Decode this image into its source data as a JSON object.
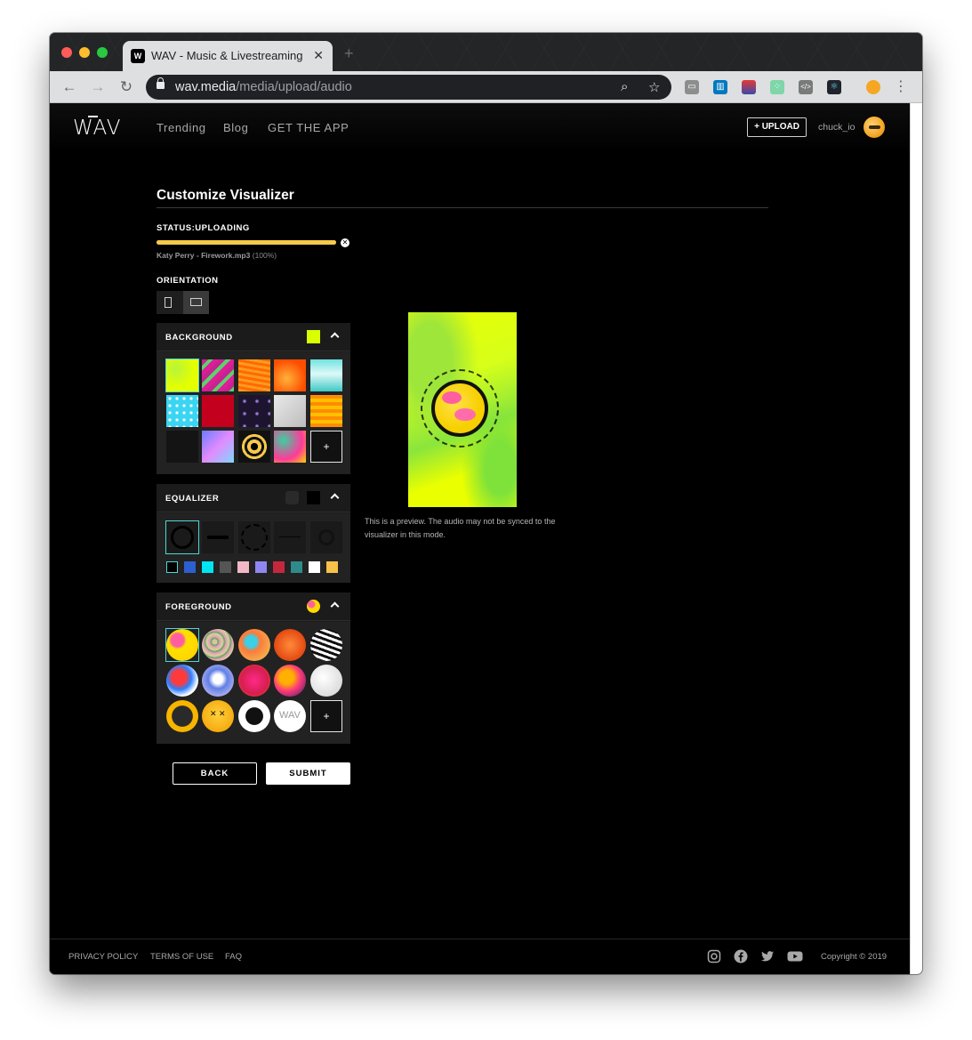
{
  "browser": {
    "tab_title": "WAV - Music & Livestreaming",
    "url_host": "wav.media",
    "url_path": "/media/upload/audio"
  },
  "header": {
    "logo": "WAV",
    "nav": [
      "Trending",
      "Blog",
      "GET THE APP"
    ],
    "upload_label": "+ UPLOAD",
    "username": "chuck_io"
  },
  "main": {
    "title": "Customize Visualizer",
    "status_label": "STATUS:UPLOADING",
    "progress_percent": 100,
    "file_name": "Katy Perry - Firework.mp3",
    "file_progress": "(100%)",
    "orientation_label": "ORIENTATION",
    "orientation_selected": "landscape",
    "background": {
      "title": "BACKGROUND",
      "selected_color": "#d9ff00",
      "add_label": "+"
    },
    "equalizer": {
      "title": "EQUALIZER",
      "colors": [
        "#000000",
        "#2e5fd1",
        "#00e5f0",
        "#555555",
        "#f2b8c6",
        "#8f86f2",
        "#c4283d",
        "#2f8a8a",
        "#ffffff",
        "#f7c14a"
      ]
    },
    "foreground": {
      "title": "FOREGROUND",
      "add_label": "+"
    },
    "back_label": "BACK",
    "submit_label": "SUBMIT",
    "preview_note": "This is a preview. The audio may not be synced to the visualizer in this mode."
  },
  "footer": {
    "links": [
      "PRIVACY POLICY",
      "TERMS OF USE",
      "FAQ"
    ],
    "social": [
      "instagram-icon",
      "facebook-icon",
      "twitter-icon",
      "youtube-icon"
    ],
    "copyright": "Copyright © 2019"
  }
}
